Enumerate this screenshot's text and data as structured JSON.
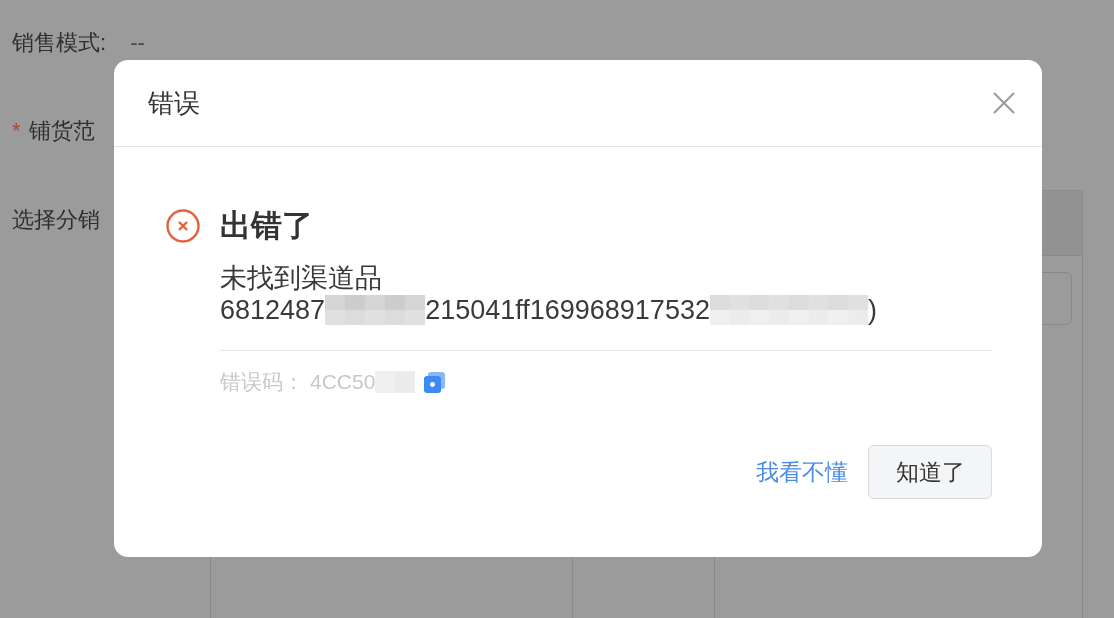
{
  "background_form": {
    "fields": [
      {
        "label": "销售模式:",
        "value": "--"
      },
      {
        "required_mark": "*",
        "label": "铺货范"
      },
      {
        "label": "选择分销"
      }
    ]
  },
  "dialog": {
    "title": "错误",
    "heading": "出错了",
    "message_lines": [
      [
        {
          "kind": "text",
          "text": "未找到渠道品"
        }
      ],
      [
        {
          "kind": "text",
          "text": "6812487"
        },
        {
          "kind": "redacted"
        },
        {
          "kind": "text",
          "text": "215041ff169968917532"
        },
        {
          "kind": "redacted"
        },
        {
          "kind": "text",
          "text": ")"
        }
      ]
    ],
    "error_code": {
      "label": "错误码：",
      "segments": [
        {
          "kind": "text",
          "text": "4CC50"
        },
        {
          "kind": "redacted"
        }
      ]
    },
    "actions": [
      {
        "kind": "link",
        "label": "我看不懂"
      },
      {
        "kind": "button",
        "label": "知道了"
      }
    ]
  }
}
